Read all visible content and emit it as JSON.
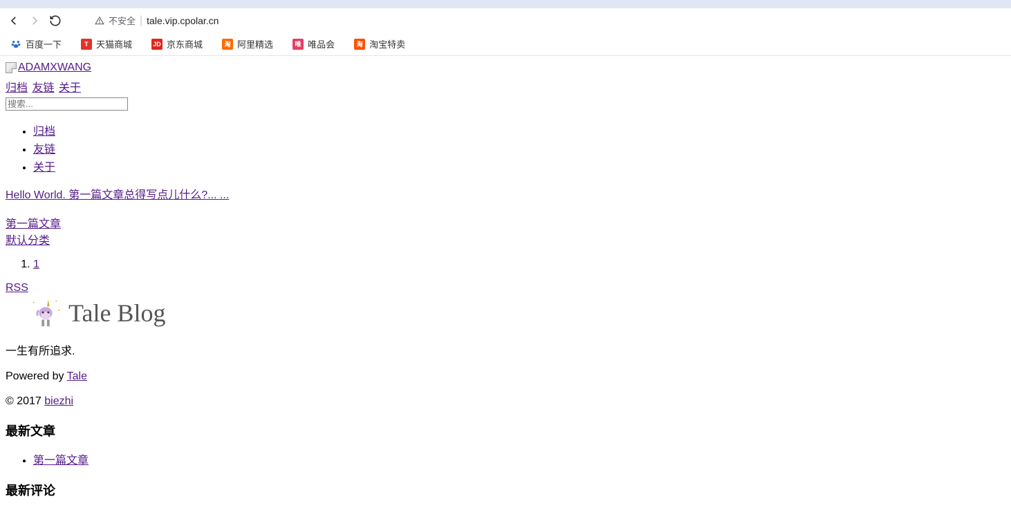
{
  "browser": {
    "insecure_label": "不安全",
    "url": "tale.vip.cpolar.cn"
  },
  "bookmarks": {
    "baidu": "百度一下",
    "tmall": "天猫商城",
    "jd": "京东商城",
    "ali": "阿里精选",
    "vip": "唯品会",
    "taobao": "淘宝特卖"
  },
  "page": {
    "logo_alt": "ADAMXWANG",
    "nav": {
      "archive": "归档",
      "links": "友链",
      "about": "关于"
    },
    "search_placeholder": "搜索...",
    "nav2": {
      "archive": "归档",
      "links": "友链",
      "about": "关于"
    },
    "post_title": "Hello World. 第一篇文章总得写点儿什么?... ...",
    "post_tag": "第一篇文章",
    "category": "默认分类",
    "pagination": {
      "page1": "1"
    },
    "rss": "RSS",
    "brand": "Tale Blog",
    "tagline": "一生有所追求.",
    "powered_prefix": "Powered by ",
    "powered_link": "Tale",
    "copyright_prefix": "© 2017 ",
    "copyright_link": "biezhi",
    "latest_articles_heading": "最新文章",
    "latest_article1": "第一篇文章",
    "latest_comments_heading": "最新评论"
  }
}
